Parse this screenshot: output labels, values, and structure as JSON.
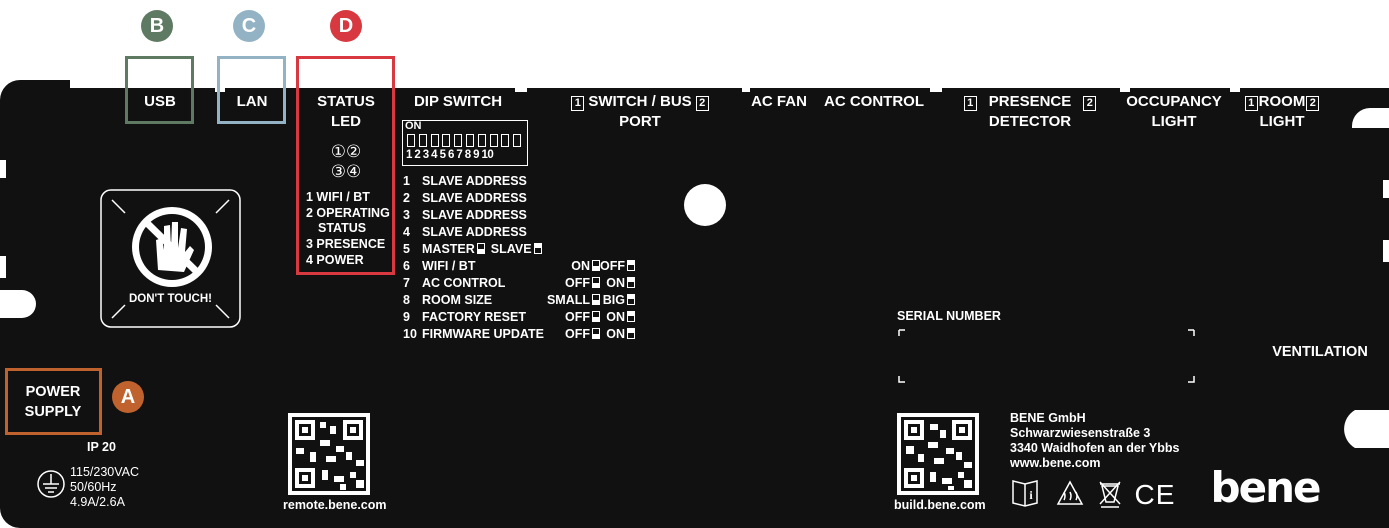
{
  "colors": {
    "panel": "#111111",
    "badge_a": "#c0622d",
    "badge_b": "#5f7a63",
    "badge_c": "#93b3c5",
    "badge_d": "#d8383f"
  },
  "badges": {
    "a": "A",
    "b": "B",
    "c": "C",
    "d": "D"
  },
  "ports": {
    "usb": "USB",
    "lan": "LAN",
    "status_1": "STATUS",
    "status_2": "LED",
    "dip": "DIP SWITCH",
    "switch_bus_1": "SWITCH / BUS",
    "switch_bus_2": "PORT",
    "ac_fan": "AC FAN",
    "ac_control": "AC CONTROL",
    "presence_1": "PRESENCE",
    "presence_2": "DETECTOR",
    "occupancy_1": "OCCUPANCY",
    "occupancy_2": "LIGHT",
    "room_1": "ROOM",
    "room_2": "LIGHT",
    "box1": "1",
    "box2": "2"
  },
  "status_led": {
    "circles": [
      "①②",
      "③④"
    ],
    "lines": [
      "1 WIFI / BT",
      "2 OPERATING",
      "STATUS",
      "3 PRESENCE",
      "4 POWER"
    ]
  },
  "dip": {
    "on": "ON",
    "numbers": "1 2 3 4 5 6 7 8 9 10",
    "rows": [
      {
        "n": "1",
        "label": "SLAVE ADDRESS"
      },
      {
        "n": "2",
        "label": "SLAVE ADDRESS"
      },
      {
        "n": "3",
        "label": "SLAVE ADDRESS"
      },
      {
        "n": "4",
        "label": "SLAVE ADDRESS"
      },
      {
        "n": "5",
        "label": "MASTER",
        "opt2": "SLAVE"
      },
      {
        "n": "6",
        "label": "WIFI / BT",
        "opt1": "ON",
        "opt2": "OFF"
      },
      {
        "n": "7",
        "label": "AC CONTROL",
        "opt1": "OFF",
        "opt2": "ON"
      },
      {
        "n": "8",
        "label": "ROOM SIZE",
        "opt1": "SMALL",
        "opt2": "BIG"
      },
      {
        "n": "9",
        "label": "FACTORY RESET",
        "opt1": "OFF",
        "opt2": "ON"
      },
      {
        "n": "10",
        "label": "FIRMWARE UPDATE",
        "opt1": "OFF",
        "opt2": "ON"
      }
    ]
  },
  "dont_touch": "DON'T TOUCH!",
  "power": {
    "line1": "POWER",
    "line2": "SUPPLY",
    "ip": "IP 20",
    "v": "115/230VAC",
    "hz": "50/60Hz",
    "a": "4.9A/2.6A"
  },
  "serial_label": "SERIAL NUMBER",
  "ventilation": "VENTILATION",
  "qr_left": "remote.bene.com",
  "qr_right": "build.bene.com",
  "company": {
    "name": "BENE GmbH",
    "street": "Schwarzwiesenstraße 3",
    "city": "3340 Waidhofen an der Ybbs",
    "web": "www.bene.com"
  },
  "logo": "bene",
  "ce": "CE"
}
